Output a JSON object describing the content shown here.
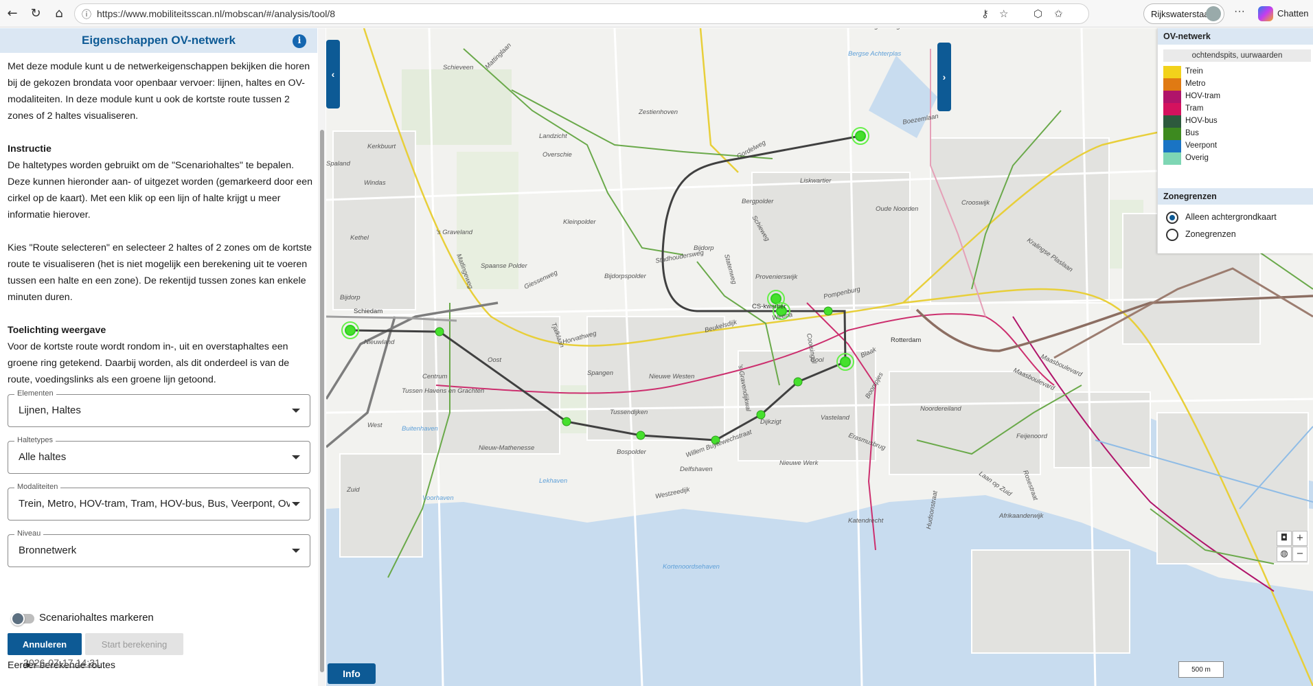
{
  "browser": {
    "url": "https://www.mobiliteitsscan.nl/mobscan/#/analysis/tool/8",
    "profile": "Rijkswaterstaat",
    "chat_label": "Chatten"
  },
  "panel": {
    "title": "Eigenschappen OV-netwerk",
    "info_icon": "i",
    "intro": "Met deze module kunt u de netwerkeigenschappen bekijken die horen bij de gekozen brondata voor openbaar vervoer: lijnen, haltes en OV-modaliteiten. In deze module kunt u ook de kortste route tussen 2 zones of 2 haltes visualiseren.",
    "instr_heading": "Instructie",
    "instr_p1": "De haltetypes worden gebruikt om de \"Scenariohaltes\" te bepalen. Deze kunnen hieronder aan- of uitgezet worden (gemarkeerd door een cirkel op de kaart). Met een klik op een lijn of halte krijgt u meer informatie hierover.",
    "instr_p2": "Kies \"Route selecteren\" en selecteer 2 haltes of 2 zones om de kortste route te visualiseren (het is niet mogelijk een berekening uit te voeren tussen een halte en een zone). De rekentijd tussen zones kan enkele minuten duren.",
    "expl_heading": "Toelichting weergave",
    "expl_p": "Voor de kortste route wordt rondom in-, uit en overstaphaltes een groene ring getekend. Daarbij worden, als dit onderdeel is van de route, voedingslinks als een groene lijn getoond.",
    "fields": [
      {
        "label": "Elementen",
        "value": "Lijnen, Haltes"
      },
      {
        "label": "Haltetypes",
        "value": "Alle haltes"
      },
      {
        "label": "Modaliteiten",
        "value": "Trein, Metro, HOV-tram, Tram, HOV-bus, Bus, Veerpont, Overig"
      },
      {
        "label": "Niveau",
        "value": "Bronnetwerk"
      }
    ],
    "toggle_label": "Scenariohaltes markeren",
    "toggle_on": false,
    "btn_cancel": "Annuleren",
    "btn_start": "Start berekening",
    "prev_title": "Eerder berekende routes",
    "prev_routes": [
      "2026-07-17 14:31"
    ]
  },
  "map": {
    "info_btn": "Info",
    "scale": "500 m",
    "labels": [
      "Schieveen",
      "Zestienhoven",
      "Landzicht",
      "Kerkbuurt",
      "Spaland",
      "Overschie",
      "Windas",
      "Kleinpolder",
      "'s Graveland",
      "Kethel",
      "Spaanse Polder",
      "Bijdorp",
      "Schiedam",
      "Nieuwland",
      "Oost",
      "Centrum",
      "Tussen Havens en Grachten",
      "West",
      "Bijdorpspolder",
      "Beukelsdijk",
      "Horvathweg",
      "Spangen",
      "Nieuwe Westen",
      "Tussendijken",
      "Bospolder",
      "Delfshaven",
      "Nieuw-Mathenesse",
      "Buitenhaven",
      "Lekhaven",
      "Voorhaven",
      "Zuid",
      "Bergpolder",
      "Liskwartier",
      "Oude Noorden",
      "Crooswijk",
      "Provenierswijk",
      "Bijdorp",
      "CS-kwartier",
      "Cool",
      "Rotterdam",
      "Dijkzigt",
      "Nieuwe Werk",
      "Noordereiland",
      "Feijenoord",
      "Afrikaanderwijk",
      "Katendrecht",
      "Kortenoordsehaven",
      "Bergse Achterplas",
      "Hillegersberg",
      "Maasboulevard",
      "Vasteland",
      "Westzeedijk",
      "Kralingse Plaslaan",
      "Boezemlaan",
      "Gordelweg",
      "Schieweg",
      "Statenweg",
      "Stadhoudersweg",
      "Giessenweg",
      "Tjalklaan",
      "Erasmusbrug",
      "Boompjes",
      "Hudsonstraat",
      "Laan op Zuid",
      "Rosestraat",
      "Weena",
      "Pompenburg",
      "Mattinglaan",
      "Matlingeweg",
      "Willem Buytewechstraat",
      "'s-Gravendijkwal",
      "Coolsingel",
      "Maasboulevard",
      "Blaak"
    ]
  },
  "legend": {
    "title": "OV-netwerk",
    "subtitle": "ochtendspits, uurwaarden",
    "items": [
      {
        "name": "Trein",
        "color": "#f2d21b"
      },
      {
        "name": "Metro",
        "color": "#e07a13"
      },
      {
        "name": "HOV-tram",
        "color": "#b0146a"
      },
      {
        "name": "Tram",
        "color": "#d4125e"
      },
      {
        "name": "HOV-bus",
        "color": "#2d5a3d"
      },
      {
        "name": "Bus",
        "color": "#3d8a1f"
      },
      {
        "name": "Veerpont",
        "color": "#1a74c4"
      },
      {
        "name": "Overig",
        "color": "#7ed6b4"
      }
    ],
    "zone_title": "Zonegrenzen",
    "zone_options": [
      {
        "label": "Alleen achtergrondkaart",
        "selected": true
      },
      {
        "label": "Zonegrenzen",
        "selected": false
      }
    ]
  }
}
